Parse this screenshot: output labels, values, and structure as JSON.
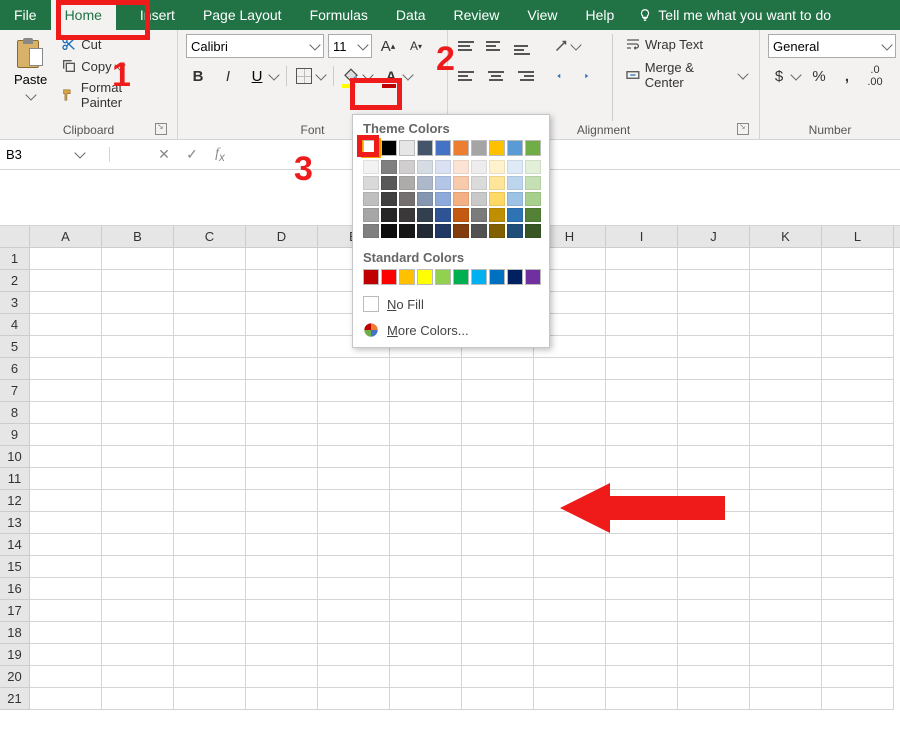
{
  "tabs": [
    "File",
    "Home",
    "Insert",
    "Page Layout",
    "Formulas",
    "Data",
    "Review",
    "View",
    "Help"
  ],
  "active_tab_index": 1,
  "tell_me": "Tell me what you want to do",
  "clipboard": {
    "paste": "Paste",
    "cut": "Cut",
    "copy": "Copy",
    "format_painter": "Format Painter",
    "group_label": "Clipboard"
  },
  "font": {
    "name": "Calibri",
    "size": "11",
    "group_label": "Font"
  },
  "alignment": {
    "wrap_text": "Wrap Text",
    "merge_center": "Merge & Center",
    "group_label": "Alignment"
  },
  "number": {
    "format": "General",
    "group_label": "Number"
  },
  "namebox": {
    "value": "B3"
  },
  "columns": [
    "A",
    "B",
    "C",
    "D",
    "E",
    "F",
    "G",
    "H",
    "I",
    "J",
    "K",
    "L"
  ],
  "rows": [
    1,
    2,
    3,
    4,
    5,
    6,
    7,
    8,
    9,
    10,
    11,
    12,
    13,
    14,
    15,
    16,
    17,
    18,
    19,
    20,
    21
  ],
  "popup": {
    "theme_title": "Theme Colors",
    "std_title": "Standard Colors",
    "no_fill": "o Fill",
    "no_fill_prefix": "N",
    "more_colors": "ore Colors...",
    "more_colors_prefix": "M",
    "theme_row": [
      "#ffffff",
      "#000000",
      "#e7e6e6",
      "#44546a",
      "#4472c4",
      "#ed7d31",
      "#a5a5a5",
      "#ffc000",
      "#5b9bd5",
      "#70ad47"
    ],
    "tints": [
      [
        "#f2f2f2",
        "#808080",
        "#d0cece",
        "#d6dce4",
        "#d9e1f2",
        "#fbe4d5",
        "#ededed",
        "#fff2cc",
        "#deeaf6",
        "#e2efd9"
      ],
      [
        "#d9d9d9",
        "#595959",
        "#aeabab",
        "#adb9ca",
        "#b4c6e7",
        "#f7caac",
        "#dbdbdb",
        "#fee599",
        "#bdd6ee",
        "#c5e0b3"
      ],
      [
        "#bfbfbf",
        "#404040",
        "#757070",
        "#8496b0",
        "#8eaadb",
        "#f4b083",
        "#c9c9c9",
        "#ffd966",
        "#9cc2e5",
        "#a8d08d"
      ],
      [
        "#a6a6a6",
        "#262626",
        "#3a3838",
        "#323f4f",
        "#2f5496",
        "#c45911",
        "#7b7b7b",
        "#bf8f00",
        "#2e74b5",
        "#538135"
      ],
      [
        "#808080",
        "#0d0d0d",
        "#171616",
        "#222a35",
        "#1f3864",
        "#833c0b",
        "#525252",
        "#806000",
        "#1f4e79",
        "#375623"
      ]
    ],
    "standard": [
      "#c00000",
      "#ff0000",
      "#ffc000",
      "#ffff00",
      "#92d050",
      "#00b050",
      "#00b0f0",
      "#0070c0",
      "#002060",
      "#7030a0"
    ]
  },
  "annotations": {
    "n1": "1",
    "n2": "2",
    "n3": "3"
  }
}
